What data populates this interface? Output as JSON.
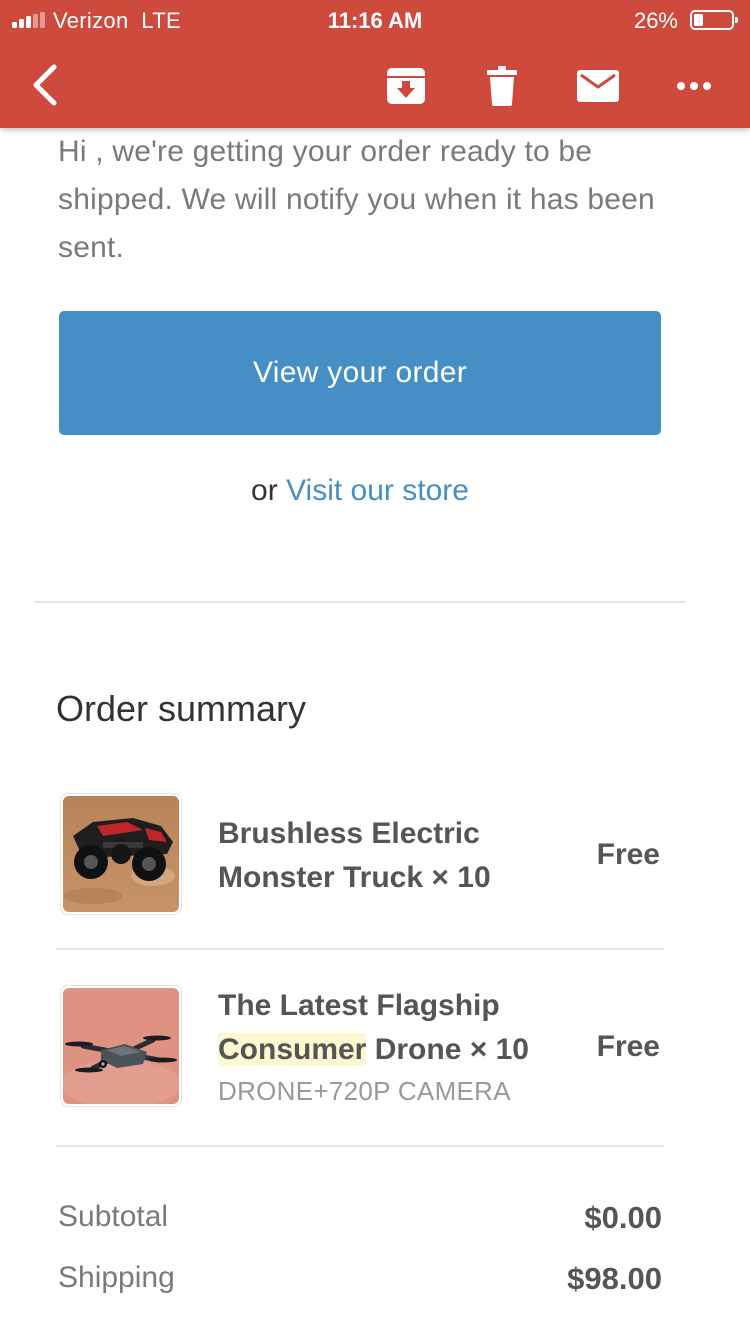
{
  "status_bar": {
    "carrier": "Verizon  LTE",
    "time": "11:16 AM",
    "battery_percent": "26%",
    "battery_level": 0.26,
    "signal_bars": 3,
    "signal_total": 5
  },
  "toolbar": {
    "back_icon": "chevron-left-icon",
    "actions": [
      "archive-icon",
      "trash-icon",
      "mail-icon",
      "more-icon"
    ],
    "color": "#cd4a3d"
  },
  "email": {
    "intro": "Hi , we're getting your order ready to be shipped. We will notify you when it has been sent.",
    "view_order_label": "View your order",
    "or_text": "or",
    "visit_store_label": "Visit our store",
    "accent": "#458fc5"
  },
  "order_summary": {
    "title": "Order summary",
    "items": [
      {
        "name": "Brushless Electric Monster Truck",
        "quantity": "× 10",
        "variant": "",
        "price": "Free",
        "image": "monster-truck-image"
      },
      {
        "name_highlighted": "Consumer",
        "name_before": "The Latest Flagship",
        "name_after": "Drone",
        "quantity": "× 10",
        "variant": "DRONE+720P CAMERA",
        "price": "Free",
        "image": "drone-image"
      }
    ],
    "subtotal_label": "Subtotal",
    "subtotal_value": "$0.00",
    "shipping_label": "Shipping",
    "shipping_value": "$98.00"
  }
}
